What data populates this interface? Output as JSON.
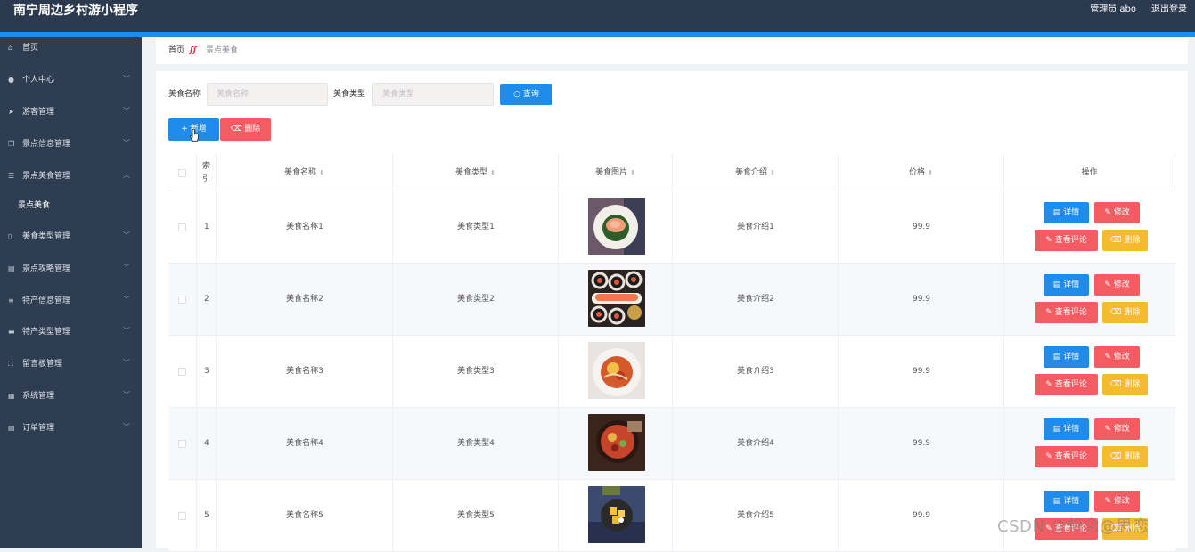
{
  "header": {
    "title": "南宁周边乡村游小程序",
    "user": "管理员 abo",
    "logout": "退出登录"
  },
  "sidebar": {
    "items": [
      {
        "label": "首页",
        "icon": "home-icon",
        "glyph": "⌂",
        "expandable": false
      },
      {
        "label": "个人中心",
        "icon": "user-icon",
        "glyph": "●",
        "expandable": true
      },
      {
        "label": "游客管理",
        "icon": "send-icon",
        "glyph": "➤",
        "expandable": true
      },
      {
        "label": "景点信息管理",
        "icon": "copy-icon",
        "glyph": "❐",
        "expandable": true
      },
      {
        "label": "景点美食管理",
        "icon": "sliders-icon",
        "glyph": "☰",
        "expandable": true,
        "open": true
      },
      {
        "label": "美食类型管理",
        "icon": "phone-icon",
        "glyph": "▯",
        "expandable": true
      },
      {
        "label": "景点攻略管理",
        "icon": "clipboard-icon",
        "glyph": "▤",
        "expandable": true
      },
      {
        "label": "特产信息管理",
        "icon": "list-icon",
        "glyph": "≡",
        "expandable": true
      },
      {
        "label": "特产类型管理",
        "icon": "stack-icon",
        "glyph": "▬",
        "expandable": true
      },
      {
        "label": "留言板管理",
        "icon": "frame-icon",
        "glyph": "⛶",
        "expandable": true
      },
      {
        "label": "系统管理",
        "icon": "grid-icon",
        "glyph": "▦",
        "expandable": true
      },
      {
        "label": "订单管理",
        "icon": "document-icon",
        "glyph": "▤",
        "expandable": true
      }
    ],
    "subitem": "景点美食"
  },
  "breadcrumb": {
    "home": "首页",
    "current": "景点美食"
  },
  "search": {
    "name_label": "美食名称",
    "name_placeholder": "美食名称",
    "type_label": "美食类型",
    "type_placeholder": "美食类型",
    "query_button": "查询"
  },
  "toolbar": {
    "add_label": "新增",
    "delete_label": "删除"
  },
  "table": {
    "columns": {
      "index": "索引",
      "name": "美食名称",
      "type": "美食类型",
      "image": "美食图片",
      "intro": "美食介绍",
      "price": "价格",
      "actions": "操作"
    },
    "rows": [
      {
        "index": "1",
        "name": "美食名称1",
        "type": "美食类型1",
        "intro": "美食介绍1",
        "price": "99.9",
        "image": "salmon-plate"
      },
      {
        "index": "2",
        "name": "美食名称2",
        "type": "美食类型2",
        "intro": "美食介绍2",
        "price": "99.9",
        "image": "sushi-rolls"
      },
      {
        "index": "3",
        "name": "美食名称3",
        "type": "美食类型3",
        "intro": "美食介绍3",
        "price": "99.9",
        "image": "tomato-noodles"
      },
      {
        "index": "4",
        "name": "美食名称4",
        "type": "美食类型4",
        "intro": "美食介绍4",
        "price": "99.9",
        "image": "spicy-stew"
      },
      {
        "index": "5",
        "name": "美食名称5",
        "type": "美食类型5",
        "intro": "美食介绍5",
        "price": "99.9",
        "image": "mango-dish"
      }
    ],
    "actions": {
      "detail": "详情",
      "edit": "修改",
      "comments": "查看评论",
      "delete": "删除"
    }
  },
  "watermark": "CSDN @想念@思恋",
  "colors": {
    "topbar": "#2b3a4f",
    "sidebar": "#2e3d52",
    "accent": "#1f8ceb",
    "danger": "#f45c63",
    "warning": "#f5b932"
  }
}
